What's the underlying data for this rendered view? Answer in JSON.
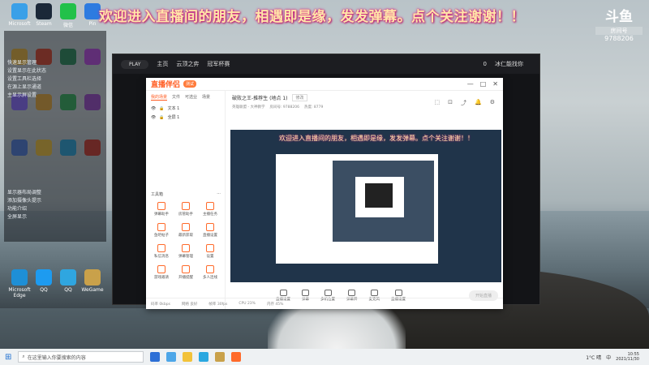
{
  "overlay": {
    "banner": "欢迎进入直播间的朋友，相遇即是缘，发发弹幕。点个关注谢谢！！",
    "logo_mark": "斗鱼",
    "logo_label": "房间号",
    "room_id": "9788206"
  },
  "desktop_icons": [
    {
      "label": "Microsoft",
      "color": "#3aa0e8"
    },
    {
      "label": "Steam",
      "color": "#1b2838"
    },
    {
      "label": "微信",
      "color": "#22c14a"
    },
    {
      "label": "Pin",
      "color": "#2d7be0"
    },
    {
      "label": "",
      "color": "#e6b23a"
    },
    {
      "label": "",
      "color": "#d7452d"
    },
    {
      "label": "",
      "color": "#2a8a5a"
    },
    {
      "label": "",
      "color": "#bb4adf"
    },
    {
      "label": "",
      "color": "#8b6cff"
    },
    {
      "label": "",
      "color": "#e7a93a"
    },
    {
      "label": "",
      "color": "#35b05b"
    },
    {
      "label": "",
      "color": "#9b4ac6"
    },
    {
      "label": "",
      "color": "#4f7ad8"
    },
    {
      "label": "",
      "color": "#f0c23a"
    },
    {
      "label": "",
      "color": "#2ba3d6"
    },
    {
      "label": "",
      "color": "#cc3b2e"
    },
    {
      "label": "Microsoft Edge",
      "color": "#1e8fd6"
    },
    {
      "label": "QQ",
      "color": "#1d9bf0"
    },
    {
      "label": "QQ",
      "color": "#2fa6e0"
    },
    {
      "label": "WeGame",
      "color": "#c9a14a"
    }
  ],
  "side_panel": {
    "lines": [
      "快速显示管理",
      "设置显示在此状态",
      "设置工具栏选择",
      "在源上显示通道",
      "主显示屏设置",
      "显示器布局调整",
      "添加摄像头提示",
      "功能介绍",
      "全屏显示"
    ]
  },
  "bg_window": {
    "play": "PLAY",
    "nav": [
      "主页",
      "云顶之弈",
      "冠军杯赛"
    ],
    "coins": "0",
    "user": "冰仁能找你"
  },
  "app": {
    "brand": "直播伴侣",
    "version": "测试",
    "window_controls": [
      "—",
      "□",
      "✕"
    ],
    "tabs": [
      "我的场景",
      "文件",
      "可选业",
      "场景"
    ],
    "sources": [
      "文本 1",
      "全屏 1"
    ],
    "tools_title": "工具箱",
    "tools_more": "···",
    "tools": [
      "弹幕助手",
      "房管助手",
      "主播任务",
      "鱼吧帖子",
      "最新获取",
      "直播设置",
      "私信消息",
      "弹幕管理",
      "设置",
      "游戏邀请",
      "开播提醒",
      "多人连线"
    ],
    "title": "破败之王-推荐生 (地点 1)",
    "title_btn": "修改",
    "sub": [
      "英雄联盟 - 大神教学",
      "房间号: 9788206",
      "热度: 8779"
    ],
    "preview_banner": "欢迎进入直播间的朋友，相遇即是缘，发发弹幕。点个关注谢谢！！",
    "controls": [
      "直播设置",
      "弹幕",
      "多机位置",
      "弹幕开",
      "麦克风",
      "直播设置"
    ],
    "go_live": "开始直播",
    "status": [
      "码率 0kbps",
      "网络 良好",
      "帧率 30fps",
      "CPU 23%",
      "内存 45%"
    ]
  },
  "taskbar": {
    "search_placeholder": "在这里输入你要搜索的内容",
    "lang": "中",
    "weather": "1°C 晴",
    "time": "10:55",
    "date": "2021/11/30"
  }
}
